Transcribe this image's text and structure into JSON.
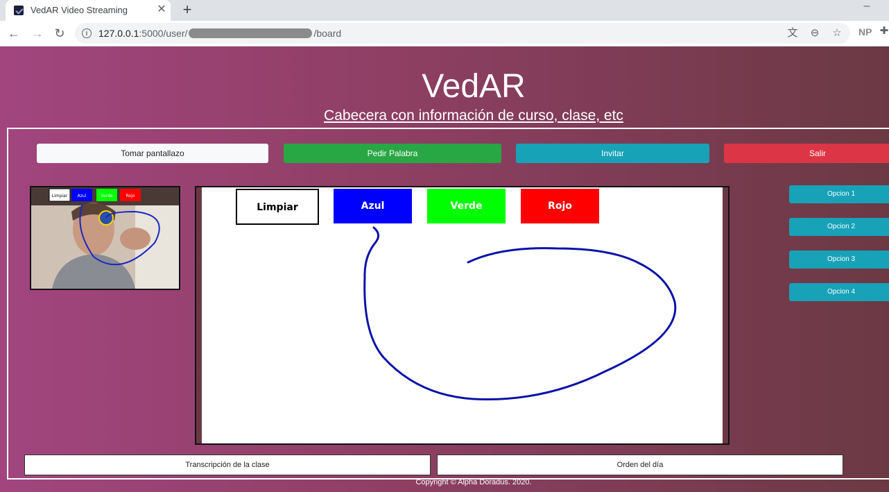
{
  "browser": {
    "tab_title": "VedAR Video Streaming",
    "url_host": "127.0.0.1",
    "url_before": ":5000/user/",
    "url_after": "/board",
    "ext_label": "NP"
  },
  "page": {
    "brand": "VedAR",
    "subtitle": "Cabecera con información de curso, clase, etc",
    "copyright": "Copyright © Alpha Doradus. 2020."
  },
  "actions": {
    "screenshot": "Tomar pantallazo",
    "raise_hand": "Pedir Palabra",
    "invite": "Invitar",
    "exit": "Salir"
  },
  "whiteboard": {
    "clear": "Limpiar",
    "blue": "Azul",
    "green": "Verde",
    "red": "Rojo",
    "stroke_color": "#0a12a8"
  },
  "webcam": {
    "labels": [
      "Limpiar",
      "Azul",
      "Verde",
      "Rojo"
    ]
  },
  "options": [
    "Opcion 1",
    "Opcion 2",
    "Opcion 3",
    "Opcion 4"
  ],
  "panels": {
    "transcript": "Transcripción de la clase",
    "agenda": "Orden del día"
  },
  "colors": {
    "green": "#28a745",
    "teal": "#17a2b8",
    "red": "#dc3545"
  }
}
